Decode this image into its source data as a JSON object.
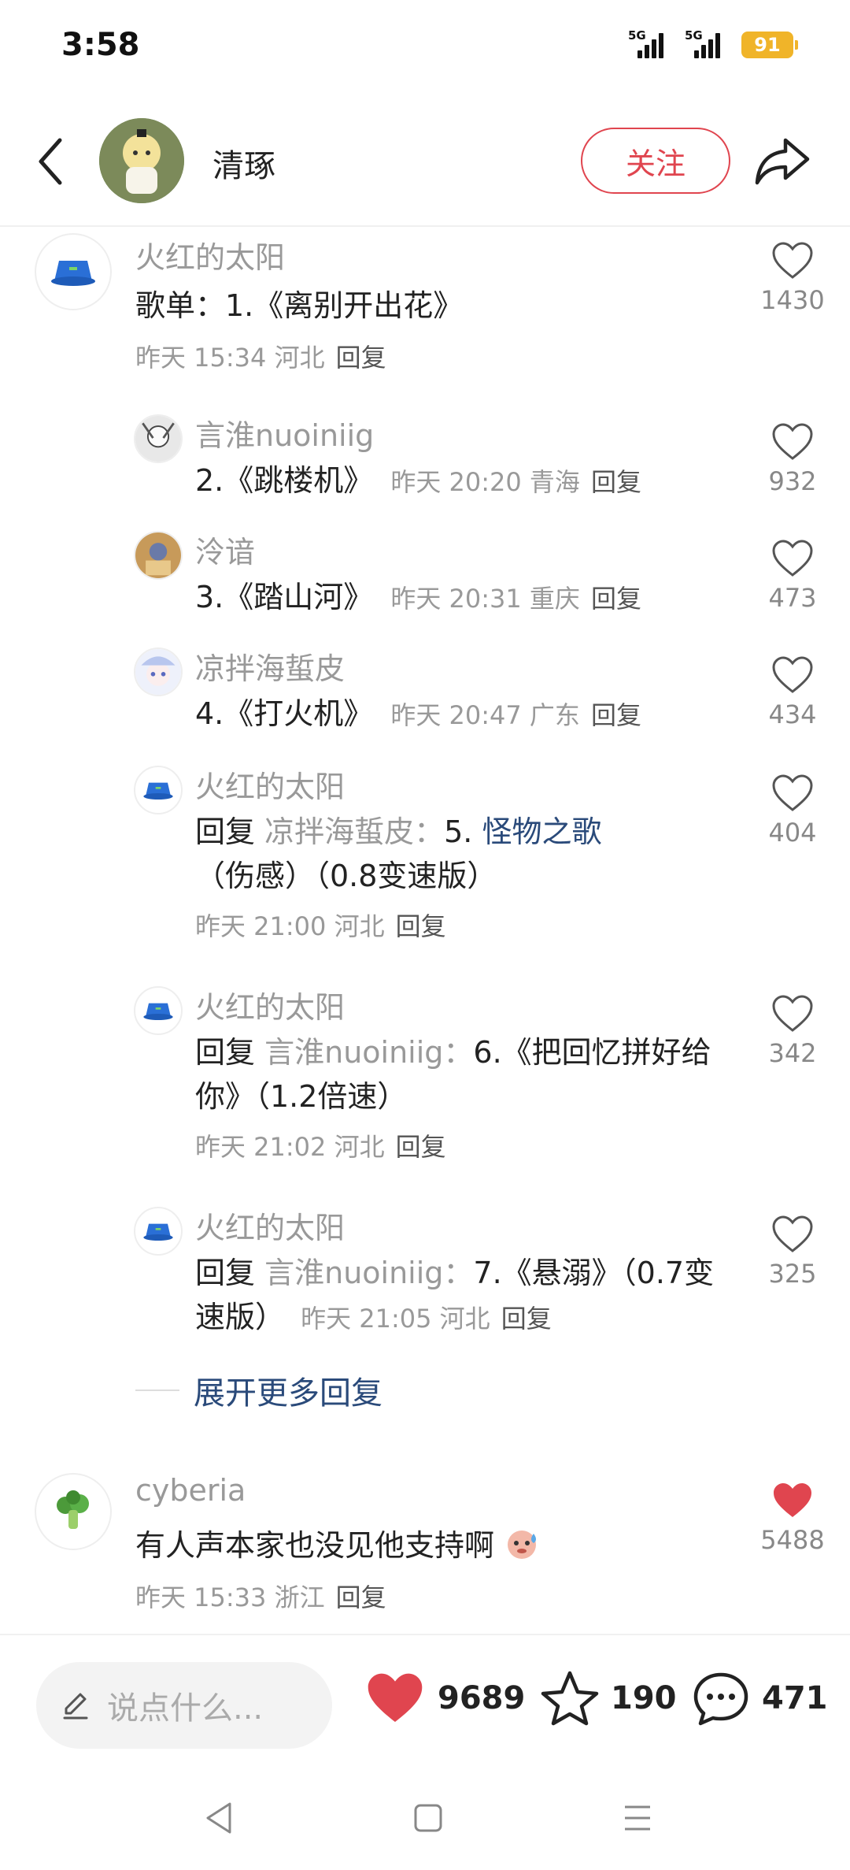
{
  "status_bar": {
    "time": "3:58",
    "signal1_label": "5G",
    "signal2_label": "5G",
    "battery": "91"
  },
  "header": {
    "title": "清琢",
    "follow_label": "关注"
  },
  "comments": [
    {
      "user": "火红的太阳",
      "text": "歌单：1.《离别开出花》",
      "meta": "昨天 15:34 河北",
      "reply_label": "回复",
      "likes": "1430",
      "liked": false
    },
    {
      "user": "言淮nuoiniig",
      "text": "2.《跳楼机》",
      "meta": "昨天 20:20 青海",
      "reply_label": "回复",
      "likes": "932"
    },
    {
      "user": "泠谙",
      "text": "3.《踏山河》",
      "meta": "昨天 20:31 重庆",
      "reply_label": "回复",
      "likes": "473"
    },
    {
      "user": "凉拌海蜇皮",
      "text": "4.《打火机》",
      "meta": "昨天 20:47 广东",
      "reply_label": "回复",
      "likes": "434"
    },
    {
      "user": "火红的太阳",
      "reply_prefix": "回复",
      "mention": "凉拌海蜇皮：",
      "text_plain": "5. ",
      "text_link": "怪物之歌",
      "text_rest": "（伤感）（0.8变速版）",
      "meta": "昨天 21:00 河北",
      "reply_label": "回复",
      "likes": "404"
    },
    {
      "user": "火红的太阳",
      "reply_prefix": "回复",
      "mention": "言淮nuoiniig：",
      "text": "6.《把回忆拼好给你》（1.2倍速）",
      "meta": "昨天 21:02 河北",
      "reply_label": "回复",
      "likes": "342"
    },
    {
      "user": "火红的太阳",
      "reply_prefix": "回复",
      "mention": "言淮nuoiniig：",
      "text": "7.《悬溺》（0.7变速版）",
      "meta": "昨天 21:05 河北",
      "reply_label": "回复",
      "likes": "325"
    },
    {
      "user": "cyberia",
      "text": "有人声本家也没见他支持啊",
      "meta": "昨天 15:33 浙江",
      "reply_label": "回复",
      "likes": "5488",
      "liked": true
    }
  ],
  "expand_label": "展开更多回复",
  "bottom_bar": {
    "input_placeholder": "说点什么...",
    "likes": "9689",
    "stars": "190",
    "comments": "471"
  },
  "colors": {
    "accent_red": "#e0454f",
    "link_blue": "#2a4a7a",
    "muted_gray": "#999999"
  },
  "icons": [
    "back-icon",
    "share-icon",
    "heart-icon",
    "star-icon",
    "chat-icon",
    "pencil-icon",
    "nav-back-icon",
    "nav-home-icon",
    "nav-menu-icon"
  ]
}
